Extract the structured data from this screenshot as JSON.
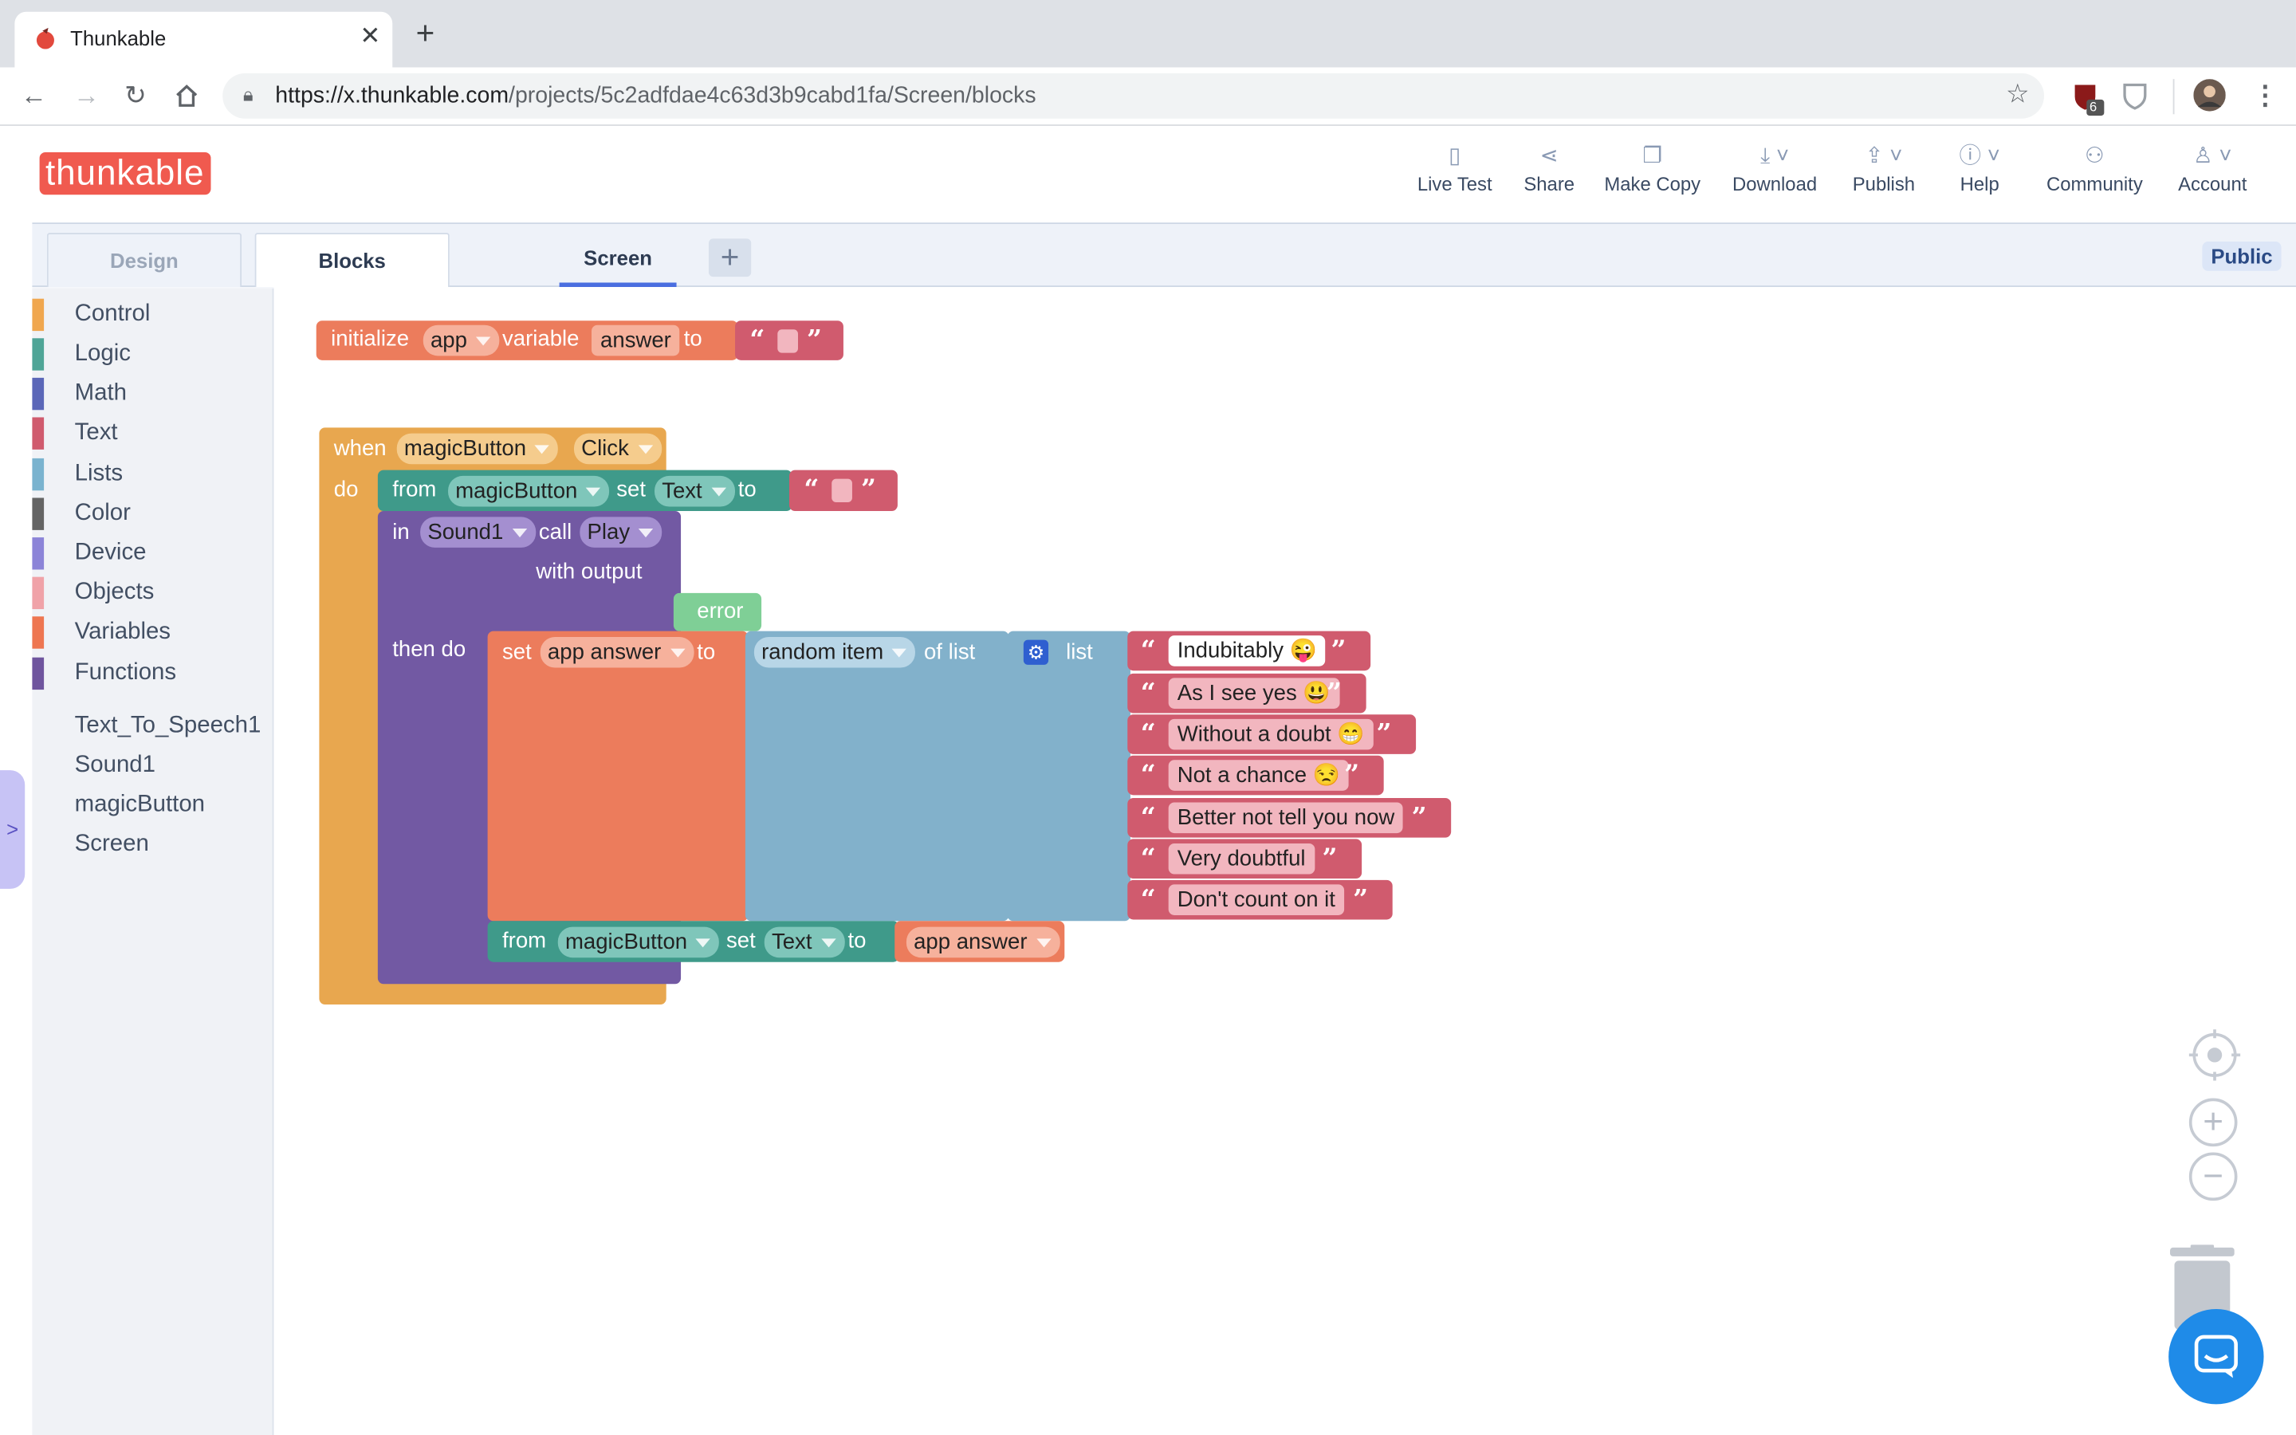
{
  "browser": {
    "tab_title": "Thunkable",
    "url_host": "https://x.thunkable.com",
    "url_path": "/projects/5c2adfdae4c63d3b9cabd1fa/Screen/blocks",
    "ext_badge": "6"
  },
  "header": {
    "logo": "thunkable",
    "nav": [
      {
        "label": "Live Test",
        "icon": "phone-icon"
      },
      {
        "label": "Share",
        "icon": "share-icon"
      },
      {
        "label": "Make Copy",
        "icon": "copy-icon"
      },
      {
        "label": "Download",
        "icon": "download-icon"
      },
      {
        "label": "Publish",
        "icon": "publish-icon"
      },
      {
        "label": "Help",
        "icon": "info-icon"
      },
      {
        "label": "Community",
        "icon": "community-icon"
      },
      {
        "label": "Account",
        "icon": "account-icon"
      }
    ]
  },
  "editor": {
    "tab_design": "Design",
    "tab_blocks": "Blocks",
    "screen_tab": "Screen",
    "add_screen": "+",
    "visibility": "Public"
  },
  "palette": {
    "categories": [
      {
        "label": "Control",
        "color": "#f0a74f"
      },
      {
        "label": "Logic",
        "color": "#4fa597"
      },
      {
        "label": "Math",
        "color": "#5b67b8"
      },
      {
        "label": "Text",
        "color": "#d05b6e"
      },
      {
        "label": "Lists",
        "color": "#7ab3cf"
      },
      {
        "label": "Color",
        "color": "#646464"
      },
      {
        "label": "Device",
        "color": "#8c84d8"
      },
      {
        "label": "Objects",
        "color": "#f0a2a8"
      },
      {
        "label": "Variables",
        "color": "#ee7651"
      },
      {
        "label": "Functions",
        "color": "#6f559e"
      }
    ],
    "components": [
      "Text_To_Speech1",
      "Sound1",
      "magicButton",
      "Screen"
    ]
  },
  "blocks": {
    "init": {
      "kw1": "initialize",
      "scope": "app",
      "kw2": "variable",
      "name": "answer",
      "kw3": "to"
    },
    "event": {
      "kw_when": "when",
      "component": "magicButton",
      "event": "Click",
      "kw_do": "do"
    },
    "set1": {
      "kw_from": "from",
      "component": "magicButton",
      "kw_set": "set",
      "prop": "Text",
      "kw_to": "to"
    },
    "call": {
      "kw_in": "in",
      "component": "Sound1",
      "kw_call": "call",
      "method": "Play",
      "output_label": "with output",
      "error": "error",
      "then_do": "then do"
    },
    "set_var": {
      "kw_set": "set",
      "var": "app answer",
      "kw_to": "to"
    },
    "random": {
      "op": "random item",
      "kw_of": "of list"
    },
    "list": {
      "kw": "list"
    },
    "answers": [
      "Indubitably 😜",
      "As I see yes 😃",
      "Without a doubt 😁",
      "Not a chance 😒",
      "Better not tell you now",
      "Very doubtful",
      "Don't count on it"
    ],
    "set2": {
      "kw_from": "from",
      "component": "magicButton",
      "kw_set": "set",
      "prop": "Text",
      "kw_to": "to",
      "value": "app answer"
    }
  },
  "colors": {
    "control": "#e8a74f",
    "text": "#d05b6e",
    "variables": "#ec7c5c",
    "components": "#3f9a8a",
    "sound": "#7259a3",
    "lists": "#82b1cb",
    "error": "#7fcf96"
  }
}
